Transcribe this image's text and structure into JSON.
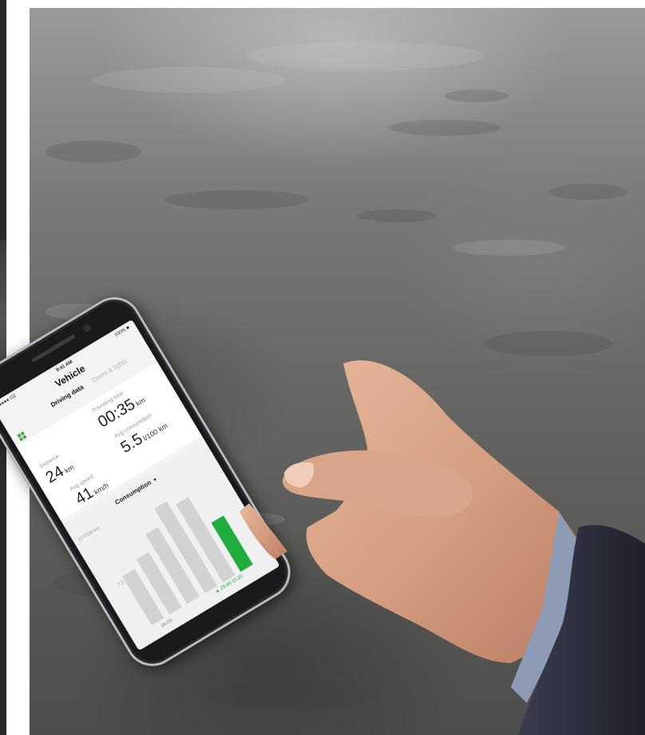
{
  "phone": {
    "status": {
      "carrier": "●●●● O2",
      "time": "9:41 AM",
      "battery": "100% ■"
    },
    "title": "Vehicle",
    "tabs": [
      {
        "label": "Driving data"
      },
      {
        "label": "Doors & lights"
      }
    ],
    "stats": [
      {
        "label": "Distance",
        "value": "24",
        "unit": "km"
      },
      {
        "label": "Travelling time",
        "value": "00:35",
        "unit": "km"
      },
      {
        "label": "Avg speed",
        "value": "41",
        "unit": "km/h"
      },
      {
        "label": "Avg consumption",
        "value": "5.5",
        "unit": "l/100 km"
      }
    ],
    "chart_selector": "Consumption",
    "chart_data": {
      "type": "bar",
      "y_ticks": [
        "10 l/100 km",
        "7.5"
      ],
      "x_ticks": [
        "20.03"
      ],
      "legend": "▲ 23:46 15:20",
      "bar_levels": [
        0.55,
        0.62,
        0.78,
        0.95,
        0.88
      ],
      "accent_bar_level": 0.55,
      "accent_color": "#1fae3e",
      "bar_color": "#d2d2d2"
    }
  },
  "colors": {
    "accent": "#1fae3e",
    "screen_bg": "#f3f3f3"
  }
}
